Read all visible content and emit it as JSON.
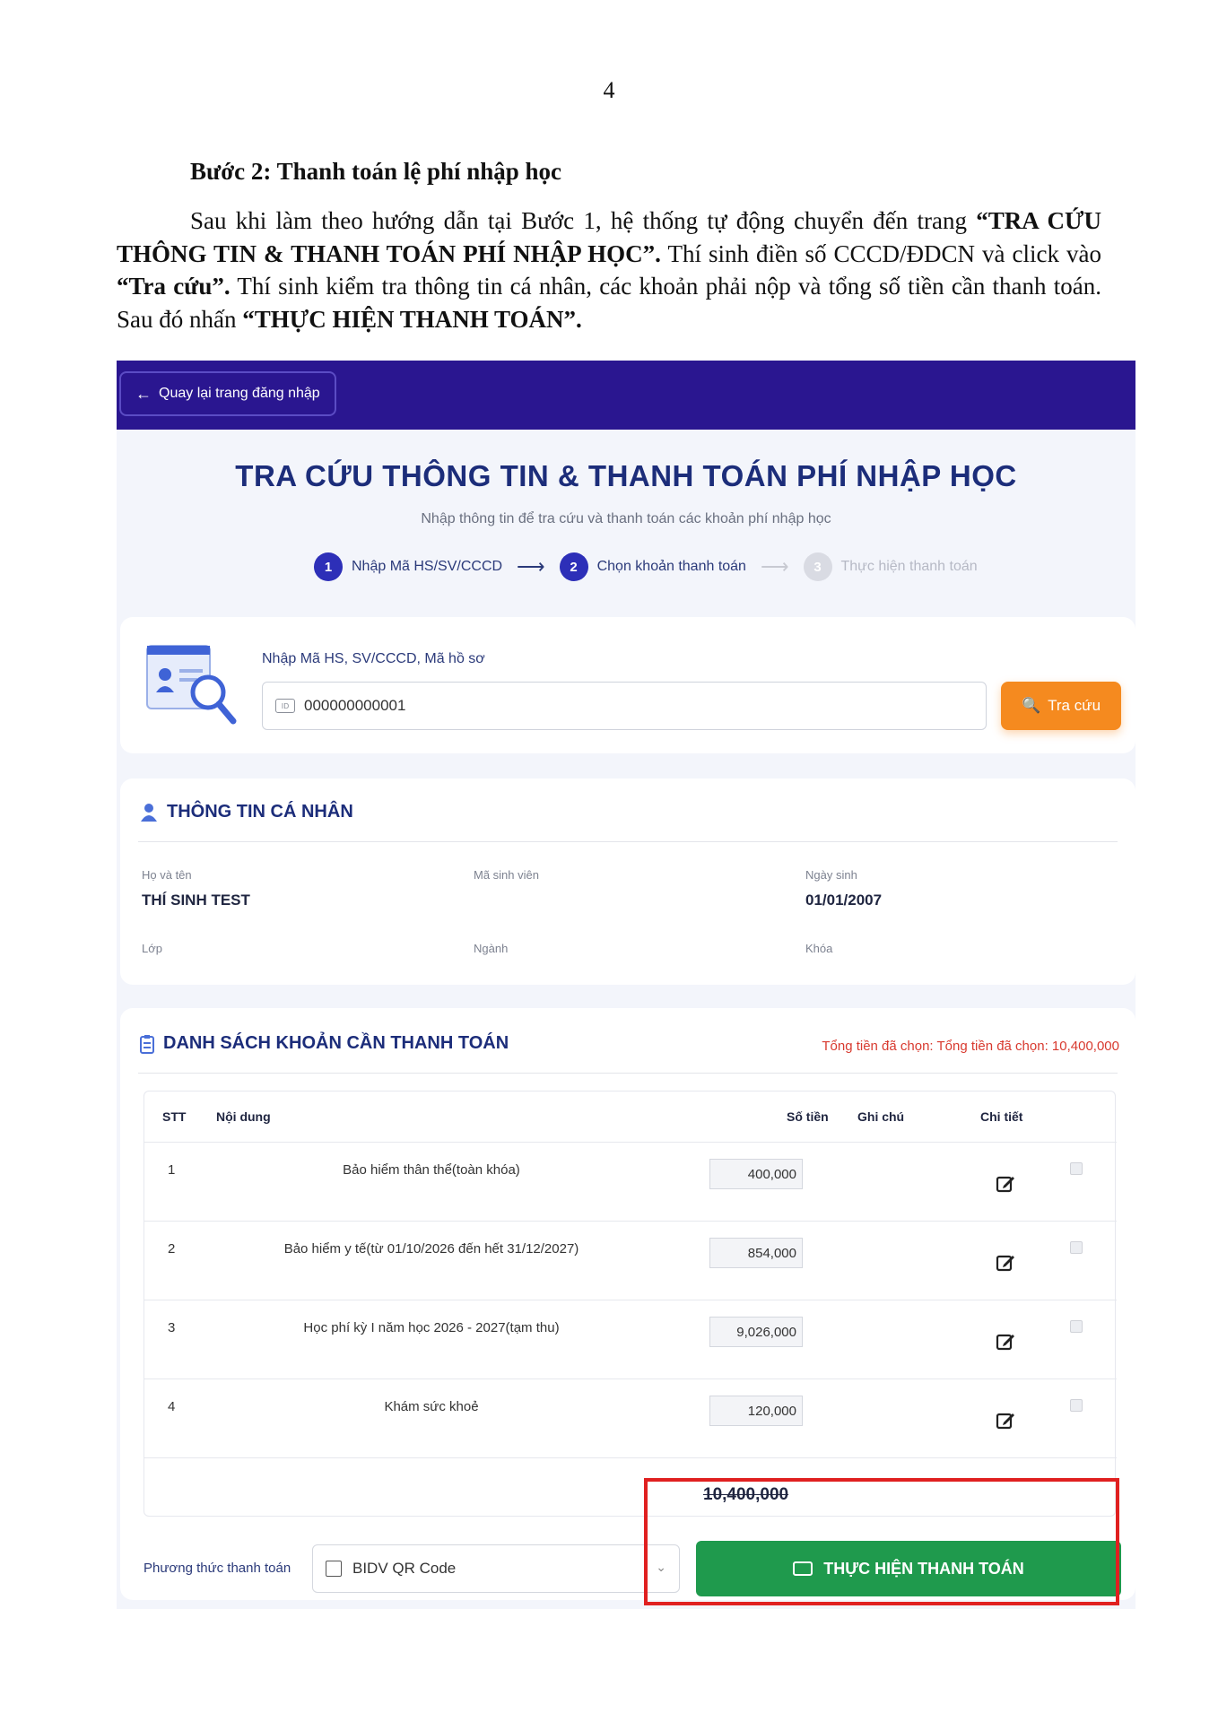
{
  "page_number": "4",
  "step_title": "Bước 2: Thanh toán lệ phí nhập học",
  "paragraph": {
    "part1": "Sau khi làm theo hướng dẫn tại Bước 1, hệ thống tự động chuyển đến trang ",
    "bold1": "“TRA CỨU THÔNG TIN & THANH TOÁN PHÍ NHẬP HỌC”.",
    "part2": " Thí sinh điền số CCCD/ĐDCN và click vào ",
    "bold2": "“Tra cứu”.",
    "part3": " Thí sinh kiểm tra thông tin cá nhân, các khoản phải nộp và tổng số tiền cần thanh toán. Sau đó nhấn ",
    "bold3": "“THỰC HIỆN THANH TOÁN”."
  },
  "screenshot": {
    "back_button": "Quay lại trang đăng nhập",
    "title": "TRA CỨU THÔNG TIN & THANH TOÁN PHÍ NHẬP HỌC",
    "subtitle": "Nhập thông tin để tra cứu và thanh toán các khoản phí nhập học",
    "steps": [
      {
        "num": "1",
        "label": "Nhập Mã HS/SV/CCCD"
      },
      {
        "num": "2",
        "label": "Chọn khoản thanh toán"
      },
      {
        "num": "3",
        "label": "Thực hiện thanh toán"
      }
    ],
    "search": {
      "label": "Nhập Mã HS, SV/CCCD, Mã hồ sơ",
      "value": "000000000001",
      "button": "Tra cứu"
    },
    "personal": {
      "heading": "THÔNG TIN CÁ NHÂN",
      "name_label": "Họ và tên",
      "name_value": "THÍ SINH TEST",
      "student_id_label": "Mã sinh viên",
      "dob_label": "Ngày sinh",
      "dob_value": "01/01/2007",
      "class_label": "Lớp",
      "major_label": "Ngành",
      "cohort_label": "Khóa"
    },
    "payments": {
      "heading": "DANH SÁCH KHOẢN CẦN THANH TOÁN",
      "total_selected": "Tổng tiền đã chọn: Tổng tiền đã chọn: 10,400,000",
      "columns": {
        "stt": "STT",
        "content": "Nội dung",
        "amount": "Số tiền",
        "note": "Ghi chú",
        "detail": "Chi tiết"
      },
      "rows": [
        {
          "stt": "1",
          "content": "Bảo hiểm thân thể(toàn khóa)",
          "amount": "400,000"
        },
        {
          "stt": "2",
          "content": "Bảo hiểm y tế(từ 01/10/2026 đến hết 31/12/2027)",
          "amount": "854,000"
        },
        {
          "stt": "3",
          "content": "Học phí kỳ I năm học 2026 - 2027(tạm thu)",
          "amount": "9,026,000"
        },
        {
          "stt": "4",
          "content": "Khám sức khoẻ",
          "amount": "120,000"
        }
      ],
      "sum": "10,400,000",
      "method_label": "Phương thức thanh toán",
      "method_value": "BIDV QR Code",
      "pay_button": "THỰC HIỆN THANH TOÁN"
    }
  },
  "colors": {
    "topbar": "#2a1690",
    "title": "#1c2d7a",
    "search_button": "#f58a1f",
    "pay_button": "#1f9a4d",
    "highlight": "#e02020",
    "total_text": "#d83a2f"
  }
}
